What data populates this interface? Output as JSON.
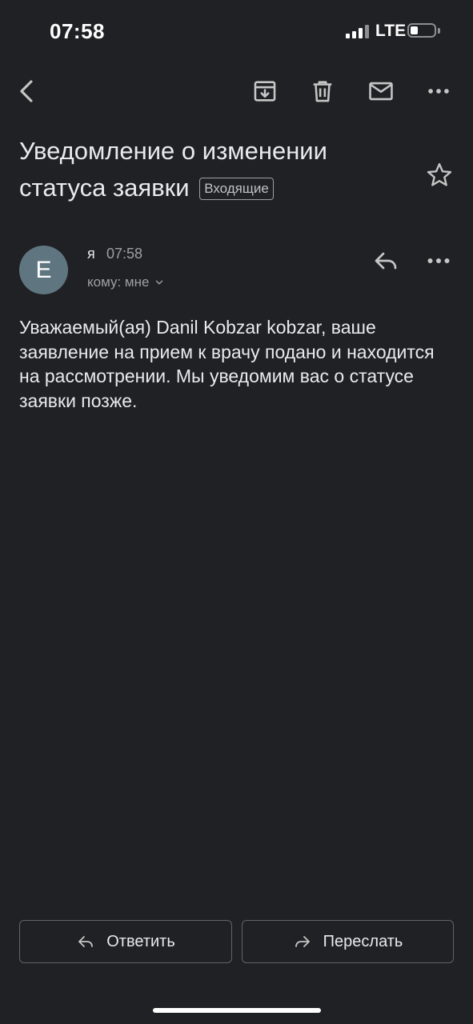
{
  "status_bar": {
    "time": "07:58",
    "network": "LTE"
  },
  "toolbar": {
    "icons": [
      "back-icon",
      "archive-icon",
      "trash-icon",
      "mail-icon",
      "more-icon"
    ]
  },
  "email": {
    "subject": "Уведомление о изменении статуса заявки",
    "label": "Входящие",
    "avatar_letter": "E",
    "sender": "я",
    "time": "07:58",
    "to": "кому: мне",
    "body": "Уважаемый(ая) Danil Kobzar kobzar, ваше заявление на прием к врачу подано и находится на рассмотрении. Мы уведомим вас о статусе заявки позже."
  },
  "actions": {
    "reply": "Ответить",
    "forward": "Переслать"
  },
  "colors": {
    "background": "#202124",
    "text": "#e8eaed",
    "secondary": "#9aa0a6",
    "avatar": "#5f7681"
  }
}
